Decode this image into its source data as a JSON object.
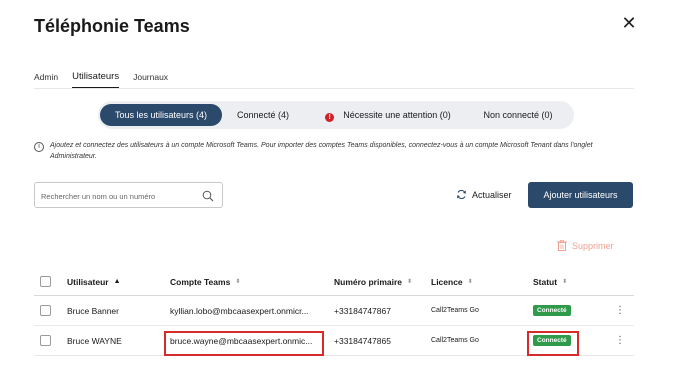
{
  "dialog": {
    "title": "Téléphonie Teams"
  },
  "tabs": [
    {
      "label": "Admin",
      "active": false
    },
    {
      "label": "Utilisateurs",
      "active": true
    },
    {
      "label": "Journaux",
      "active": false
    }
  ],
  "filters": [
    {
      "label": "Tous les utilisateurs (4)",
      "active": true
    },
    {
      "label": "Connecté (4)",
      "active": false
    },
    {
      "label": "Nécessite une attention (0)",
      "active": false,
      "icon": "warning-icon"
    },
    {
      "label": "Non connecté (0)",
      "active": false
    }
  ],
  "info": {
    "icon": "info-icon",
    "text": "Ajoutez et connectez des utilisateurs à un compte Microsoft Teams. Pour importer des comptes Teams disponibles, connectez-vous à un compte Microsoft Tenant dans l'onglet Administrateur."
  },
  "toolbar": {
    "search_placeholder": "Rechercher un nom ou un numéro",
    "refresh_label": "Actualiser",
    "add_label": "Ajouter utilisateurs",
    "delete_label": "Supprimer"
  },
  "table": {
    "columns": [
      "Utilisateur",
      "Compte Teams",
      "Numéro primaire",
      "Licence",
      "Statut"
    ],
    "rows": [
      {
        "user": "Bruce Banner",
        "team_account": "kyllian.lobo@mbcaasexpert.onmicr...",
        "number": "+33184747867",
        "license": "Call2Teams Go",
        "status": "Connecté"
      },
      {
        "user": "Bruce WAYNE",
        "team_account": "bruce.wayne@mbcaasexpert.onmic...",
        "number": "+33184747865",
        "license": "Call2Teams Go",
        "status": "Connecté"
      }
    ]
  },
  "colors": {
    "primary": "#2b4a6b",
    "success": "#2e9a4a",
    "danger": "#d0202a",
    "highlight": "#d62b2b"
  }
}
